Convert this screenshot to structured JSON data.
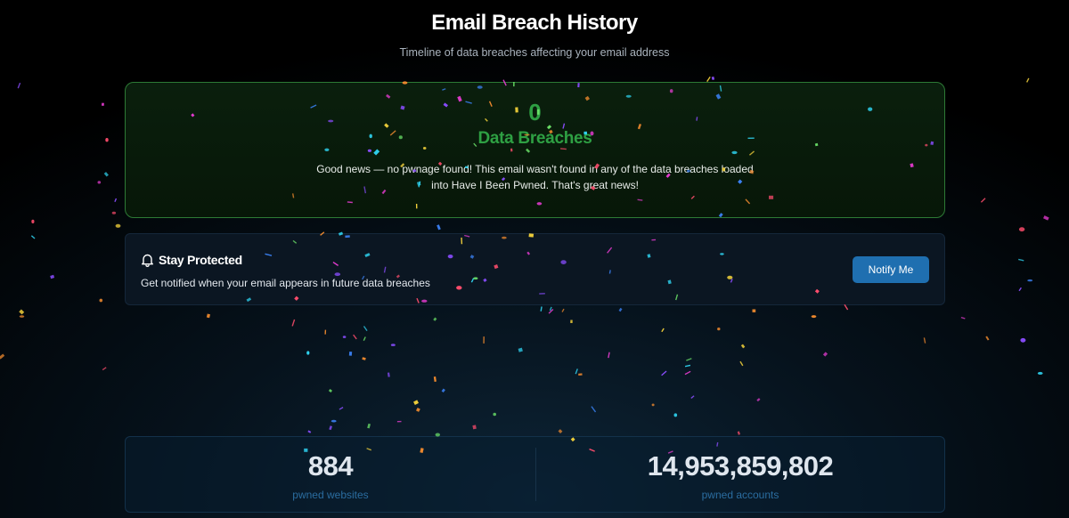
{
  "header": {
    "title": "Email Breach History",
    "subtitle": "Timeline of data breaches affecting your email address"
  },
  "result": {
    "count": "0",
    "label": "Data Breaches",
    "message": "Good news — no pwnage found! This email wasn't found in any of the data breaches loaded into Have I Been Pwned. That's great news!"
  },
  "notify": {
    "title": "Stay Protected",
    "description": "Get notified when your email appears in future data breaches",
    "button_label": "Notify Me",
    "icon": "bell-icon"
  },
  "stats": {
    "websites_value": "884",
    "websites_label": "pwned websites",
    "accounts_value": "14,953,859,802",
    "accounts_label": "pwned accounts"
  },
  "colors": {
    "success": "#2ea043",
    "accent_button": "#1f6fb0",
    "stat_label": "#2b6da0",
    "confetti": [
      "#e63bd1",
      "#8a4dff",
      "#2fd3f0",
      "#f5d33b",
      "#6ee86b",
      "#f08a2e",
      "#ff4d6d",
      "#3b82f6"
    ]
  }
}
